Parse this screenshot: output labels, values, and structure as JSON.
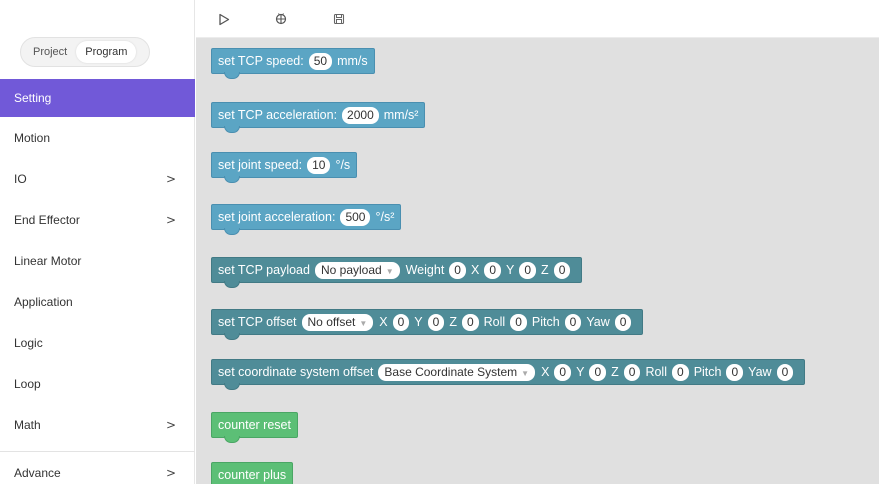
{
  "sidebar": {
    "tabs": [
      {
        "label": "Project"
      },
      {
        "label": "Program"
      }
    ],
    "items": [
      {
        "label": "Setting",
        "chevron": ""
      },
      {
        "label": "Motion",
        "chevron": ""
      },
      {
        "label": "IO",
        "chevron": ">"
      },
      {
        "label": "End Effector",
        "chevron": ">"
      },
      {
        "label": "Linear Motor",
        "chevron": ""
      },
      {
        "label": "Application",
        "chevron": ""
      },
      {
        "label": "Logic",
        "chevron": ""
      },
      {
        "label": "Loop",
        "chevron": ""
      },
      {
        "label": "Math",
        "chevron": ">"
      },
      {
        "label": "Advance",
        "chevron": ">"
      }
    ]
  },
  "toolbar": {
    "icons": [
      "play-icon",
      "debug-icon",
      "save-icon"
    ]
  },
  "blocks": {
    "tcp_speed": {
      "label": "set TCP speed:",
      "value": "50",
      "unit": "mm/s"
    },
    "tcp_accel": {
      "label": "set TCP acceleration:",
      "value": "2000",
      "unit": "mm/s²"
    },
    "joint_speed": {
      "label": "set joint speed:",
      "value": "10",
      "unit": "°/s"
    },
    "joint_accel": {
      "label": "set joint acceleration:",
      "value": "500",
      "unit": "°/s²"
    },
    "tcp_payload": {
      "label": "set TCP payload",
      "dropdown": "No payload",
      "weight_label": "Weight",
      "weight": "0",
      "x_label": "X",
      "x": "0",
      "y_label": "Y",
      "y": "0",
      "z_label": "Z",
      "z": "0"
    },
    "tcp_offset": {
      "label": "set TCP offset",
      "dropdown": "No offset",
      "x_label": "X",
      "x": "0",
      "y_label": "Y",
      "y": "0",
      "z_label": "Z",
      "z": "0",
      "roll_label": "Roll",
      "roll": "0",
      "pitch_label": "Pitch",
      "pitch": "0",
      "yaw_label": "Yaw",
      "yaw": "0"
    },
    "coord_offset": {
      "label": "set coordinate system offset",
      "dropdown": "Base Coordinate System",
      "x_label": "X",
      "x": "0",
      "y_label": "Y",
      "y": "0",
      "z_label": "Z",
      "z": "0",
      "roll_label": "Roll",
      "roll": "0",
      "pitch_label": "Pitch",
      "pitch": "0",
      "yaw_label": "Yaw",
      "yaw": "0"
    },
    "counter_reset": {
      "label": "counter reset"
    },
    "counter_plus": {
      "label": "counter plus"
    }
  },
  "colors": {
    "accent": "#7159d8",
    "block_setting": "#5ba5c4",
    "block_dark": "#4f8c98",
    "block_counter": "#5cbf76",
    "workspace_bg": "#e0e0e0"
  }
}
